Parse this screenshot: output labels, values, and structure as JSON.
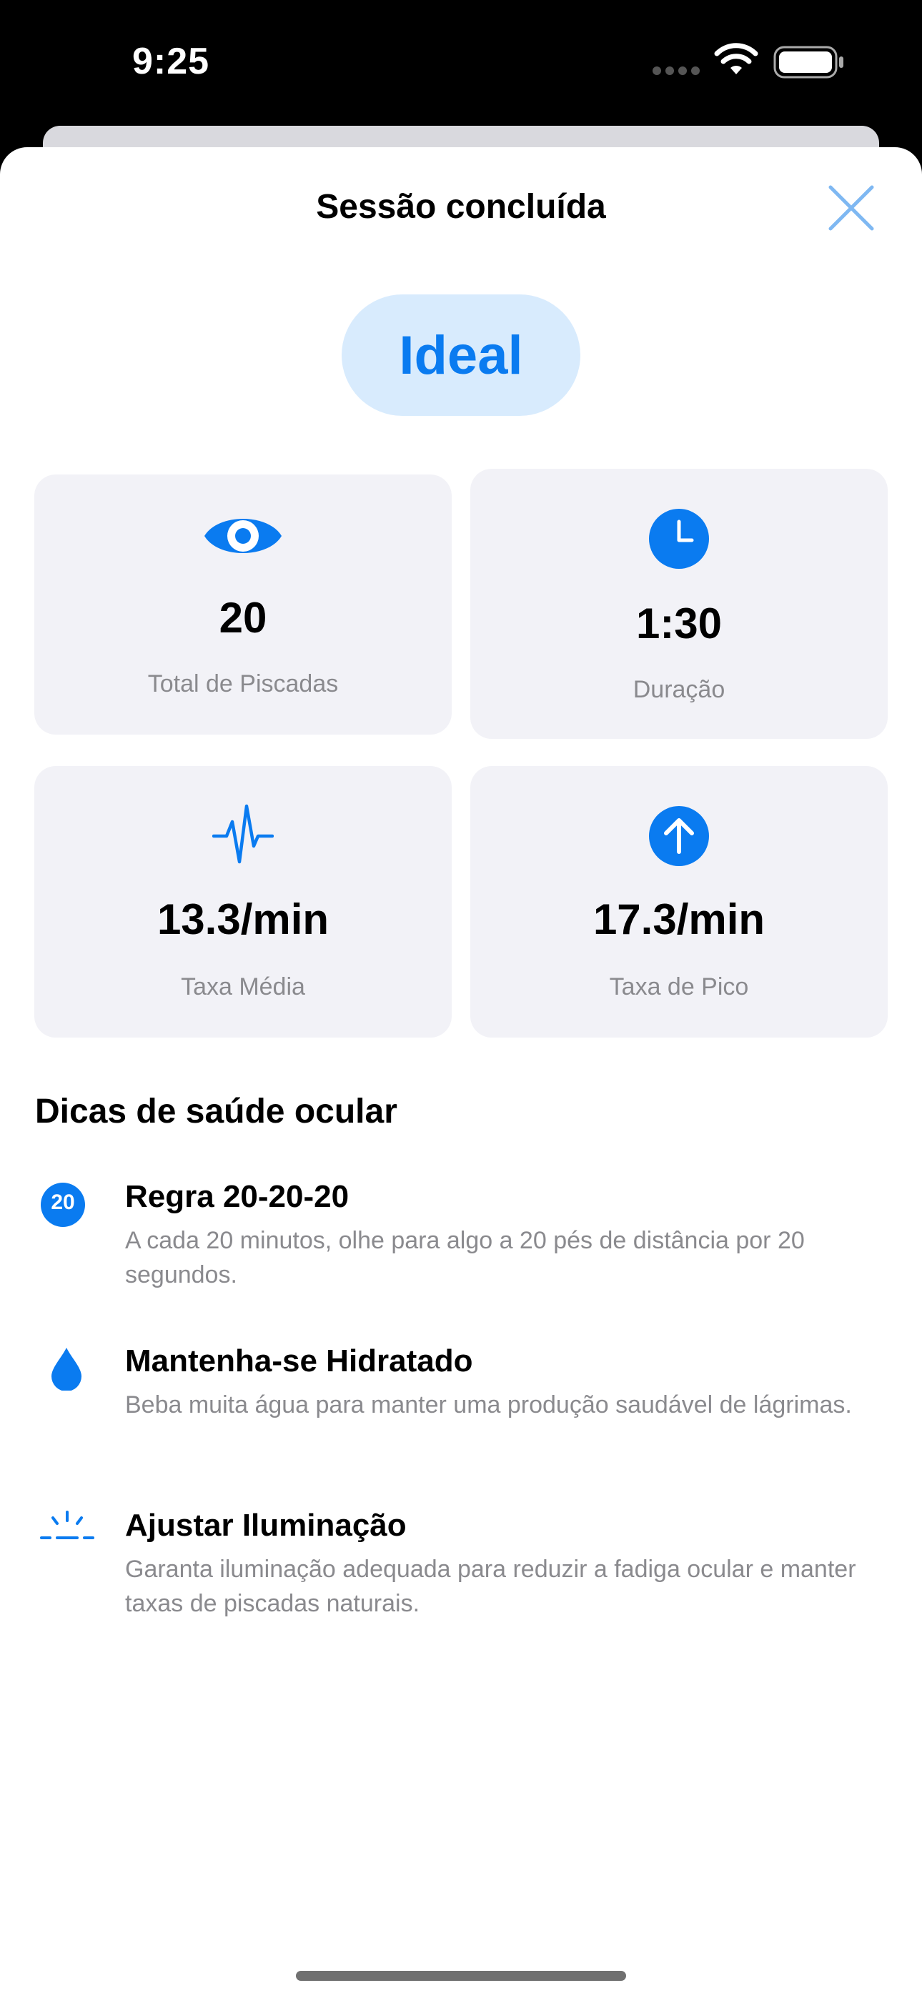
{
  "status_bar": {
    "time": "9:25"
  },
  "sheet": {
    "title": "Sessão concluída",
    "close_icon": "close-icon",
    "status_label": "Ideal"
  },
  "stats": [
    {
      "icon": "eye-icon",
      "value": "20",
      "label": "Total de Piscadas"
    },
    {
      "icon": "clock-icon",
      "value": "1:30",
      "label": "Duração"
    },
    {
      "icon": "waveform-icon",
      "value": "13.3/min",
      "label": "Taxa Média"
    },
    {
      "icon": "arrow-up-circle-icon",
      "value": "17.3/min",
      "label": "Taxa de Pico"
    }
  ],
  "tips": {
    "heading": "Dicas de saúde ocular",
    "items": [
      {
        "icon": "twenty-badge-icon",
        "badge": "20",
        "title": "Regra 20-20-20",
        "description": "A cada 20 minutos, olhe para algo a 20 pés de distância por 20 segundos."
      },
      {
        "icon": "drop-icon",
        "title": "Mantenha-se Hidratado",
        "description": "Beba muita água para manter uma produção saudável de lágrimas."
      },
      {
        "icon": "sun-horizon-icon",
        "title": "Ajustar Iluminação",
        "description": "Garanta iluminação adequada para reduzir a fadiga ocular e manter taxas de piscadas naturais."
      }
    ]
  },
  "colors": {
    "accent": "#0a7bf0",
    "pill_background": "#d8ebfd",
    "card_background": "#f2f2f7",
    "secondary_text": "#8a8a8e"
  }
}
